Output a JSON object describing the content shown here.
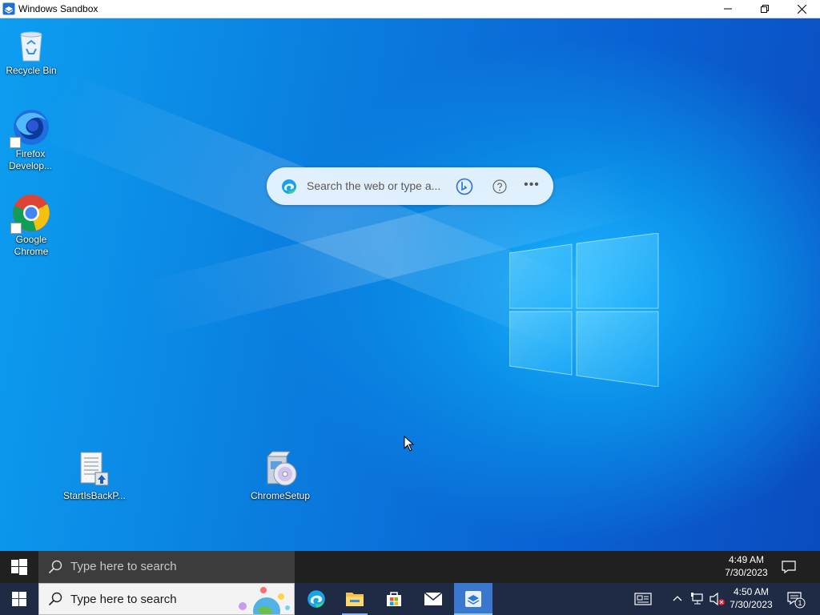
{
  "window": {
    "title": "Windows Sandbox",
    "controls": [
      "minimize",
      "restore",
      "close"
    ]
  },
  "desktop": {
    "icons": [
      {
        "label": "Recycle Bin",
        "icon": "recycle-bin-icon"
      },
      {
        "label": "Firefox Develop...",
        "icon": "firefox-developer-icon"
      },
      {
        "label": "Google Chrome",
        "icon": "chrome-icon"
      },
      {
        "label": "StartIsBackP...",
        "icon": "installer-document-icon"
      },
      {
        "label": "ChromeSetup",
        "icon": "setup-cd-icon"
      }
    ],
    "edge_search": {
      "placeholder": "Search the web or type a...",
      "icons": [
        "edge-icon",
        "bing-chat-icon",
        "help-icon",
        "more-icon"
      ]
    }
  },
  "taskbar_top": {
    "search_placeholder": "Type here to search",
    "time": "4:49 AM",
    "date": "7/30/2023"
  },
  "taskbar_bottom": {
    "search_placeholder": "Type here to search",
    "pinned": [
      "edge-icon",
      "file-explorer-icon",
      "store-icon",
      "mail-icon",
      "sandbox-icon"
    ],
    "tray_icons": [
      "news-icon",
      "chevron-up-icon",
      "network-icon",
      "volume-muted-icon"
    ],
    "time": "4:50 AM",
    "date": "7/30/2023",
    "notification_count": "1"
  },
  "colors": {
    "desktop_blue": "#0a7fe0",
    "taskbar_dark": "#202020",
    "taskbar_blue": "#1f2a44",
    "active_app": "#3a77cf"
  }
}
